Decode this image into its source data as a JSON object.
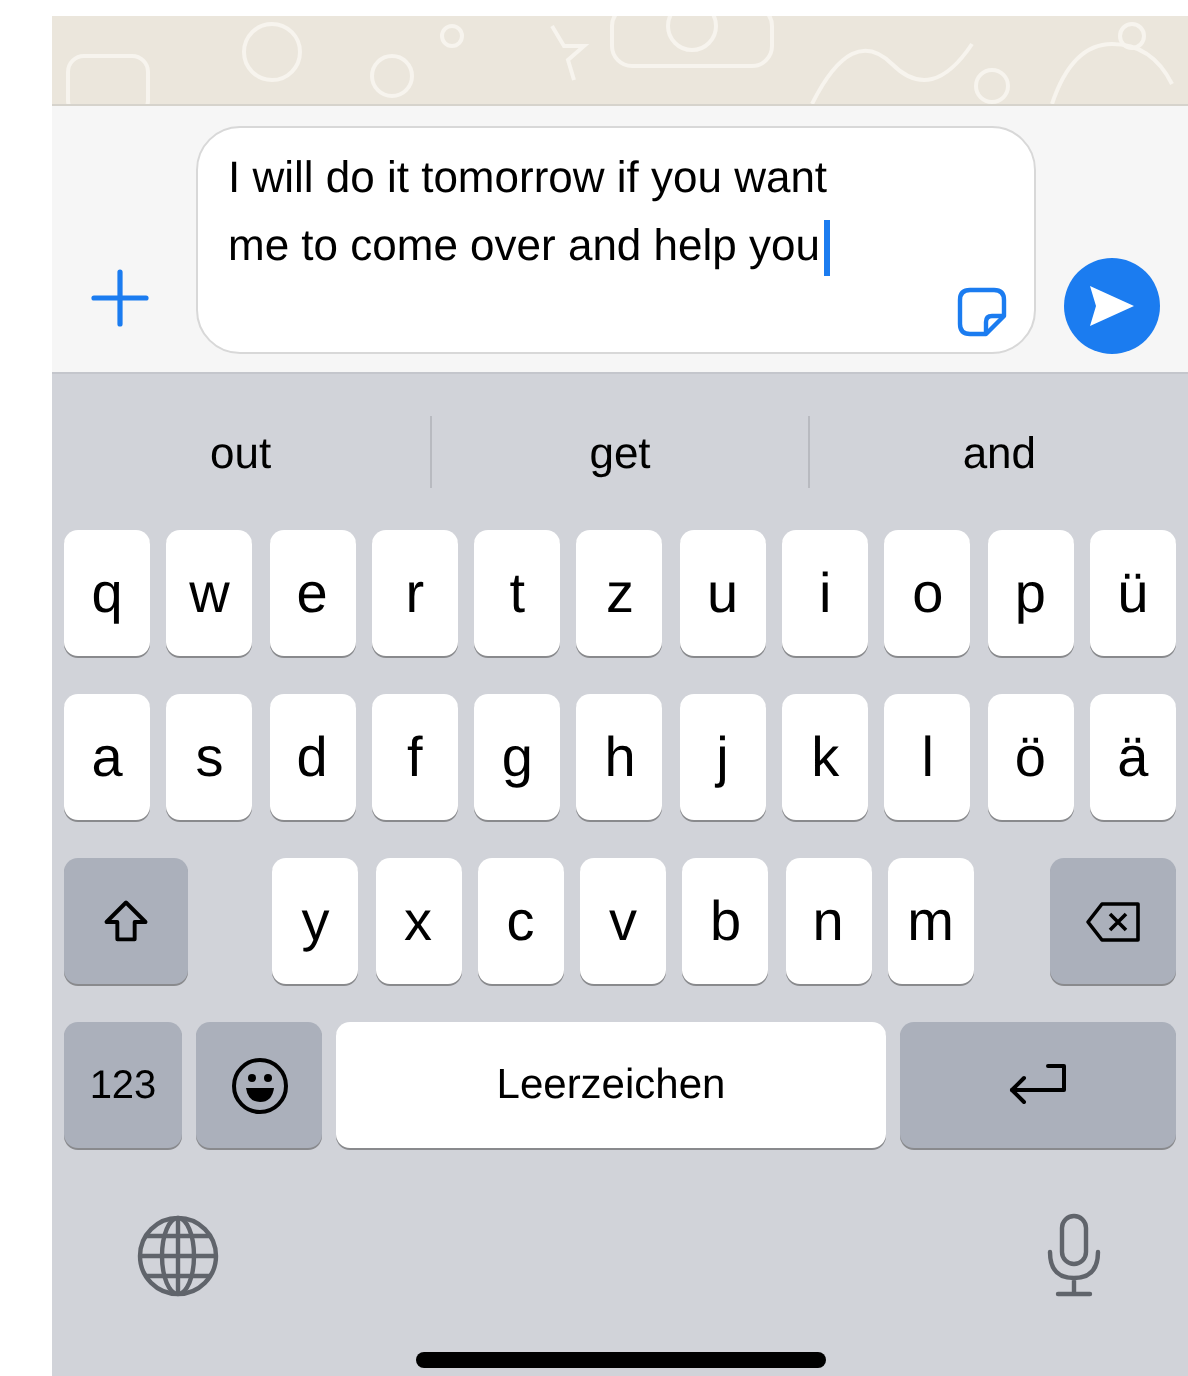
{
  "composer": {
    "value": "I will do it tomorrow if you want me to come over and help you"
  },
  "suggestions": [
    "out",
    "get",
    "and"
  ],
  "keyboard": {
    "rows": [
      {
        "keys": [
          {
            "kind": "letter",
            "label": "q"
          },
          {
            "kind": "letter",
            "label": "w"
          },
          {
            "kind": "letter",
            "label": "e"
          },
          {
            "kind": "letter",
            "label": "r"
          },
          {
            "kind": "letter",
            "label": "t"
          },
          {
            "kind": "letter",
            "label": "z"
          },
          {
            "kind": "letter",
            "label": "u"
          },
          {
            "kind": "letter",
            "label": "i"
          },
          {
            "kind": "letter",
            "label": "o"
          },
          {
            "kind": "letter",
            "label": "p"
          },
          {
            "kind": "letter",
            "label": "ü"
          }
        ]
      },
      {
        "keys": [
          {
            "kind": "letter",
            "label": "a"
          },
          {
            "kind": "letter",
            "label": "s"
          },
          {
            "kind": "letter",
            "label": "d"
          },
          {
            "kind": "letter",
            "label": "f"
          },
          {
            "kind": "letter",
            "label": "g"
          },
          {
            "kind": "letter",
            "label": "h"
          },
          {
            "kind": "letter",
            "label": "j"
          },
          {
            "kind": "letter",
            "label": "k"
          },
          {
            "kind": "letter",
            "label": "l"
          },
          {
            "kind": "letter",
            "label": "ö"
          },
          {
            "kind": "letter",
            "label": "ä"
          }
        ]
      },
      {
        "keys": [
          {
            "kind": "shift"
          },
          {
            "kind": "letter",
            "label": "y"
          },
          {
            "kind": "letter",
            "label": "x"
          },
          {
            "kind": "letter",
            "label": "c"
          },
          {
            "kind": "letter",
            "label": "v"
          },
          {
            "kind": "letter",
            "label": "b"
          },
          {
            "kind": "letter",
            "label": "n"
          },
          {
            "kind": "letter",
            "label": "m"
          },
          {
            "kind": "backspace"
          }
        ]
      },
      {
        "keys": [
          {
            "kind": "numbers",
            "label": "123"
          },
          {
            "kind": "emoji"
          },
          {
            "kind": "space",
            "label": "Leerzeichen"
          },
          {
            "kind": "return"
          }
        ]
      }
    ]
  }
}
